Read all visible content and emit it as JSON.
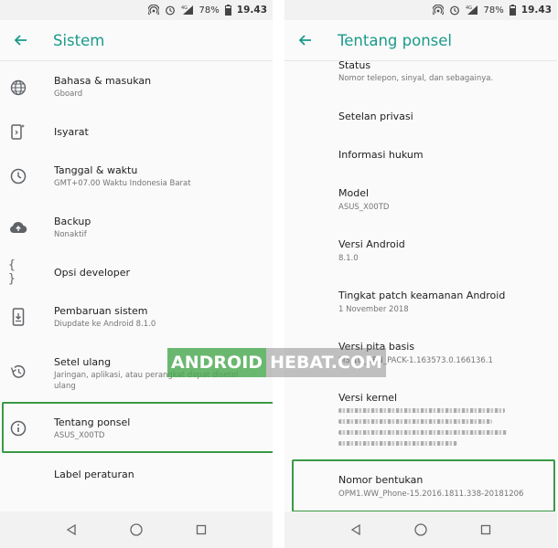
{
  "status_bar": {
    "battery": "78%",
    "time": "19.43",
    "network": "4G"
  },
  "left": {
    "title": "Sistem",
    "items": [
      {
        "label": "Bahasa & masukan",
        "sub": "Gboard",
        "icon": "globe-icon"
      },
      {
        "label": "Isyarat",
        "sub": "",
        "icon": "gesture-phone-icon"
      },
      {
        "label": "Tanggal & waktu",
        "sub": "GMT+07.00 Waktu Indonesia Barat",
        "icon": "clock-icon"
      },
      {
        "label": "Backup",
        "sub": "Nonaktif",
        "icon": "cloud-upload-icon"
      },
      {
        "label": "Opsi developer",
        "sub": "",
        "icon": "braces-icon"
      },
      {
        "label": "Pembaruan sistem",
        "sub": "Diupdate ke Android 8.1.0",
        "icon": "system-update-icon"
      },
      {
        "label": "Setel ulang",
        "sub1": "Jaringan, aplikasi, atau perangkat dapat disetel",
        "sub2": "ulang",
        "icon": "restore-icon"
      },
      {
        "label": "Tentang ponsel",
        "sub": "ASUS_X00TD",
        "icon": "info-icon"
      },
      {
        "label": "Label peraturan",
        "sub": "",
        "icon": ""
      }
    ]
  },
  "right": {
    "title": "Tentang ponsel",
    "items": [
      {
        "label": "Status",
        "sub": "Nomor telepon, sinyal, dan sebagainya."
      },
      {
        "label": "Setelan privasi",
        "sub": ""
      },
      {
        "label": "Informasi hukum",
        "sub": ""
      },
      {
        "label": "Model",
        "sub": "ASUS_X00TD"
      },
      {
        "label": "Versi Android",
        "sub": "8.1.0"
      },
      {
        "label": "Tingkat patch keamanan Android",
        "sub": "1 November 2018"
      },
      {
        "label": "Versi pita basis",
        "sub": "M3.10_GEN_PACK-1.163573.0.166136.1"
      },
      {
        "label": "Versi kernel",
        "sub": ""
      },
      {
        "label": "Nomor bentukan",
        "sub": "OPM1.WW_Phone-15.2016.1811.338-20181206"
      }
    ]
  },
  "watermark": {
    "part1": "ANDROID",
    "part2": "HEBAT.COM"
  },
  "colors": {
    "accent": "#1a9a8b",
    "highlight": "#3a9a46"
  }
}
